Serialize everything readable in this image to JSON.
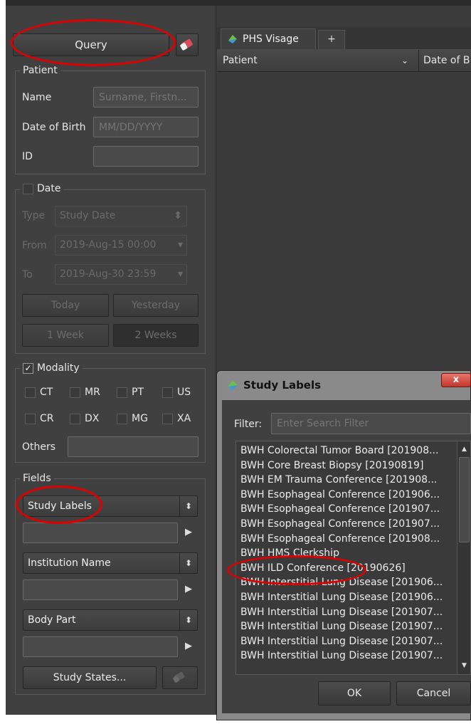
{
  "query_panel": {
    "query_label": "Query",
    "patient": {
      "legend": "Patient",
      "name_label": "Name",
      "name_placeholder": "Surname, Firstn...",
      "dob_label": "Date of Birth",
      "dob_placeholder": "MM/DD/YYYY",
      "id_label": "ID"
    },
    "date": {
      "legend": "Date",
      "checked": false,
      "type_label": "Type",
      "type_value": "Study Date",
      "from_label": "From",
      "from_value": "2019-Aug-15 00:00",
      "to_label": "To",
      "to_value": "2019-Aug-30 23:59",
      "today_label": "Today",
      "yesterday_label": "Yesterday",
      "one_week_label": "1 Week",
      "two_weeks_label": "2 Weeks"
    },
    "modality": {
      "legend": "Modality",
      "checked": true,
      "options": [
        "CT",
        "MR",
        "PT",
        "US",
        "CR",
        "DX",
        "MG",
        "XA"
      ],
      "others_label": "Others"
    },
    "fields": {
      "legend": "Fields",
      "field1": "Study Labels",
      "field2": "Institution Name",
      "field3": "Body Part",
      "study_states_label": "Study States..."
    }
  },
  "workspace": {
    "tab_label": "PHS Visage",
    "add_tab_label": "+",
    "col_patient": "Patient",
    "col_dob": "Date of B"
  },
  "dialog": {
    "title": "Study Labels",
    "close_label": "x",
    "filter_label": "Filter:",
    "filter_placeholder": "Enter Search Filter",
    "items": [
      "BWH Colorectal Tumor Board [201908...",
      "BWH Core Breast Biopsy [20190819]",
      "BWH EM Trauma Conference [201908...",
      "BWH Esophageal Conference [201906...",
      "BWH Esophageal Conference [201907...",
      "BWH Esophageal Conference [201907...",
      "BWH Esophageal Conference [201908...",
      "BWH HMS Clerkship",
      "BWH ILD Conference [20190626]",
      "BWH Interstitial Lung Disease [201906...",
      "BWH Interstitial Lung Disease [201906...",
      "BWH Interstitial Lung Disease [201907...",
      "BWH Interstitial Lung Disease [201907...",
      "BWH Interstitial Lung Disease [201907...",
      "BWH Interstitial Lung Disease [201907..."
    ],
    "ok_label": "OK",
    "cancel_label": "Cancel"
  },
  "colors": {
    "panel_bg": "#404040",
    "highlight_ring": "#e00000",
    "dialog_frame": "#8a8a8a"
  }
}
